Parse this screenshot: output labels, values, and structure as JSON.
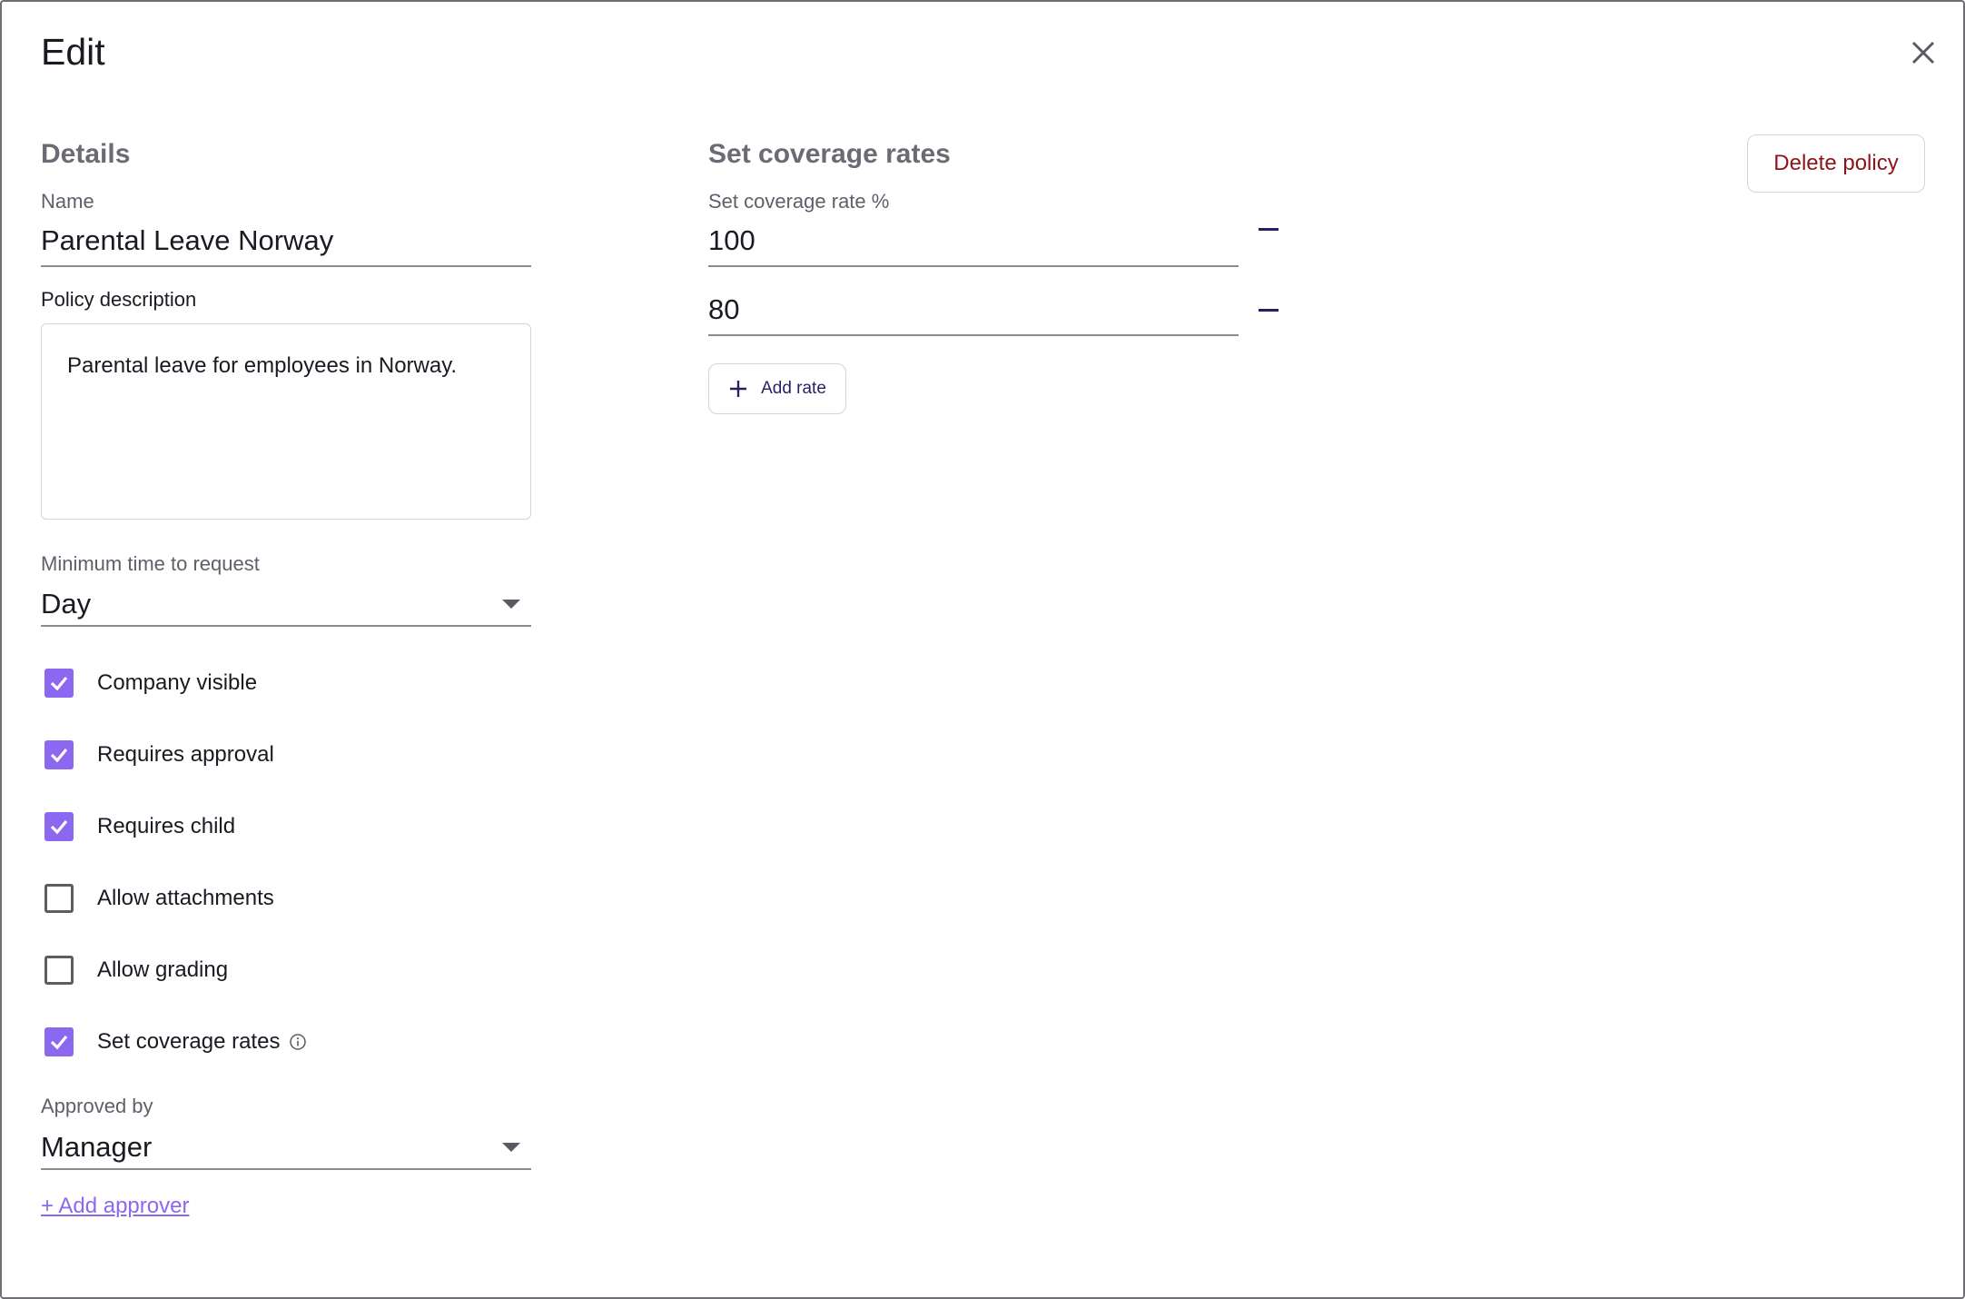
{
  "dialog": {
    "title": "Edit"
  },
  "details": {
    "heading": "Details",
    "name_label": "Name",
    "name_value": "Parental Leave Norway",
    "description_label": "Policy description",
    "description_value": "Parental leave for employees in Norway.",
    "min_time_label": "Minimum time to request",
    "min_time_value": "Day",
    "checkboxes": [
      {
        "label": "Company visible",
        "checked": true
      },
      {
        "label": "Requires approval",
        "checked": true
      },
      {
        "label": "Requires child",
        "checked": true
      },
      {
        "label": "Allow attachments",
        "checked": false
      },
      {
        "label": "Allow grading",
        "checked": false
      },
      {
        "label": "Set coverage rates",
        "checked": true
      }
    ],
    "approved_by_label": "Approved by",
    "approved_by_value": "Manager",
    "add_approver_label": "+ Add approver"
  },
  "coverage": {
    "heading": "Set coverage rates",
    "rate_label": "Set coverage rate %",
    "rates": [
      "100",
      "80"
    ],
    "add_rate_label": "Add rate"
  },
  "actions": {
    "delete_label": "Delete policy"
  },
  "colors": {
    "accent": "#8c67ef",
    "danger": "#8d1418",
    "dark_indigo": "#2a1f63"
  },
  "icons": {
    "close": "close-icon",
    "info": "info-icon",
    "plus": "plus-icon",
    "minus": "minus-icon",
    "dropdown": "chevron-down-icon",
    "check": "checkmark-icon"
  }
}
